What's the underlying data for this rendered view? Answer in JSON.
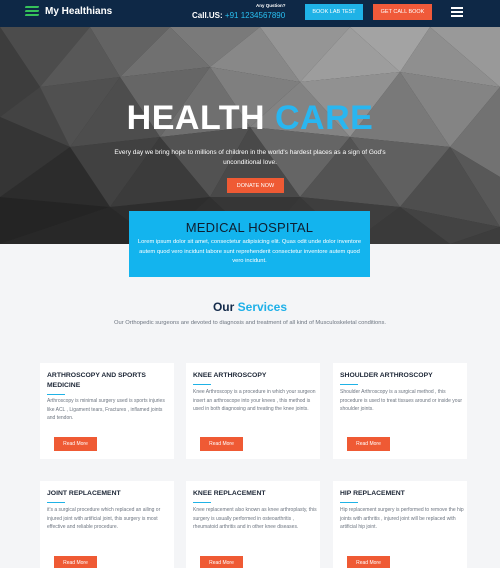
{
  "header": {
    "logo_text": "My Healthians",
    "any_question": "Any Qustion?",
    "call_label": "Call.US:",
    "call_number": "+91 1234567890",
    "book_lab_test": "BOOK LAB TEST",
    "get_call_book": "GET CALL BOOK"
  },
  "hero": {
    "title_white": "HEALTH",
    "title_blue": "CARE",
    "subtitle": "Every day we bring hope to millions of children in the world's hardest places as a sign of God's unconditional love.",
    "donate": "DONATE NOW"
  },
  "medical": {
    "title": "MEDICAL HOSPITAL",
    "text": "Lorem ipsum dolor sit amet, consectetur adipisicing elit. Quas odit unde dolor inventore autem quod vero incidunt labore sunt reprehenderit consectetur inventore autem quod vero incidunt."
  },
  "services": {
    "title_plain": "Our",
    "title_highlight": "Services",
    "subtitle": "Our Orthopedic surgeons are devoted to diagnosis and treatment of all kind of Musculoskeletal conditions.",
    "read_more": "Read More",
    "cards": [
      {
        "title": "ARTHROSCOPY AND SPORTS MEDICINE",
        "text": "Arthroscopy is minimal surgery used is sports injuries like ACL , Ligament tears, Fractures , inflamed joints and tendon."
      },
      {
        "title": "KNEE ARTHROSCOPY",
        "text": "Knee Arthroscopy is a procedure in which your surgeon insert an arthroscope into your knees , this method is used in both diagnosing and treating the knee joints."
      },
      {
        "title": "SHOULDER ARTHROSCOPY",
        "text": "Shoulder Arthroscopy is a surgical method , this procedure is used to treat tissues around or inside your shoulder joints."
      },
      {
        "title": "JOINT REPLACEMENT",
        "text": "it's a surgical procedure which replaced an ailing or injured joint with artificial joint, this surgery is most effective and reliable procedure."
      },
      {
        "title": "KNEE REPLACEMENT",
        "text": "Knee replacement also known as knee arthroplasty, this surgery is usually performed in osteoarthritis , rheumatoid arthritis and in other knee diseases."
      },
      {
        "title": "HIP REPLACEMENT",
        "text": "Hip replacement surgery is performed to remove the hip joints with arthritis , injured joint will be replaced with artificial hip joint."
      }
    ]
  },
  "colors": {
    "header_bg": "#0e2846",
    "accent_blue": "#1fb2e6",
    "accent_orange": "#ef5a34"
  }
}
